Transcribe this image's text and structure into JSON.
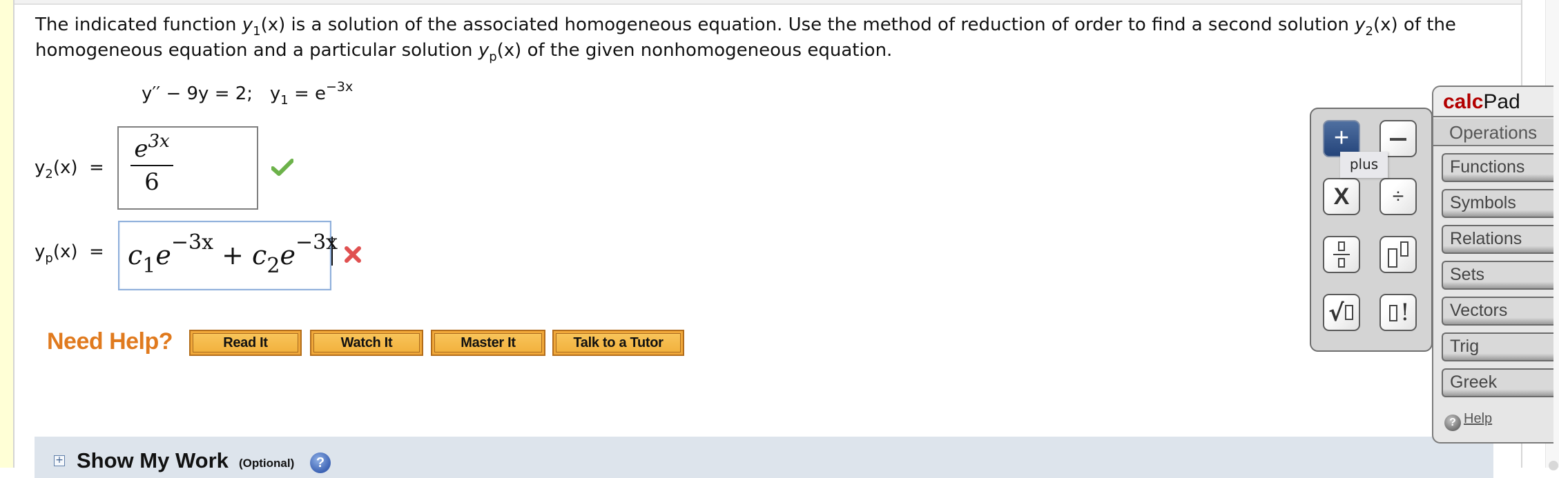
{
  "question": {
    "prompt_parts": {
      "p1": "The indicated function ",
      "y1_var": "y",
      "y1_sub": "1",
      "p2": "(x) is a solution of the associated homogeneous equation. Use the method of reduction of order to find a second solution ",
      "y2_var": "y",
      "y2_sub": "2",
      "p3": "(x) of the",
      "p4": "homogeneous equation and a particular solution ",
      "yp_var": "y",
      "yp_sub": "p",
      "p5": "(x) of the given nonhomogeneous equation."
    },
    "equation": {
      "lhs": "y′′ − 9y = 2;",
      "y1_label": "y",
      "y1_sub": "1",
      "eq": " = e",
      "exponent": "−3x"
    }
  },
  "answers": [
    {
      "label_var": "y",
      "label_sub": "2",
      "label_rest": "(x)  =",
      "numerator_base": "e",
      "numerator_exp": "3x",
      "denominator": "6",
      "status": "correct",
      "status_color": "#6cb24a"
    },
    {
      "label_var": "y",
      "label_sub": "p",
      "label_rest": "(x)  =",
      "term1_coef": "c",
      "term1_sub": "1",
      "term1_base": "e",
      "term1_exp": "−3x",
      "plus": " + ",
      "term2_coef": "c",
      "term2_sub": "2",
      "term2_base": "e",
      "term2_exp": "−3x",
      "status": "incorrect",
      "status_color": "#e05050"
    }
  ],
  "help": {
    "title": "Need Help?",
    "buttons": [
      "Read It",
      "Watch It",
      "Master It",
      "Talk to a Tutor"
    ]
  },
  "show_my_work": {
    "expand": "+",
    "title": "Show My Work",
    "optional": "(Optional)",
    "help_icon": "?"
  },
  "calcpad": {
    "brand_bold": "calc",
    "brand_rest": "Pad",
    "active_tab": "Operations",
    "tabs": [
      "Functions",
      "Symbols",
      "Relations",
      "Sets",
      "Vectors",
      "Trig",
      "Greek"
    ],
    "help": "Help",
    "keys": {
      "plus": "+",
      "times": "X",
      "divide": "÷"
    },
    "tooltip": "plus"
  }
}
